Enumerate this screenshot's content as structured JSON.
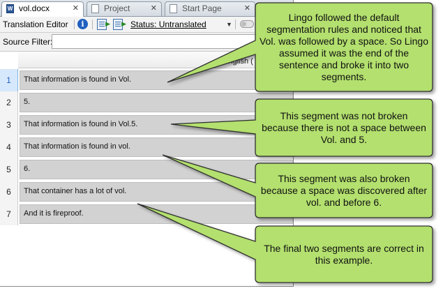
{
  "tabs": [
    {
      "label": "vol.docx",
      "icon": "word-document-icon",
      "close": "✕"
    },
    {
      "label": "Project",
      "icon": "project-icon",
      "close": "✕"
    },
    {
      "label": "Start Page",
      "icon": "start-page-icon",
      "close": "✕"
    }
  ],
  "toolbar": {
    "title": "Translation Editor",
    "info_glyph": "i",
    "status": "Status: Untranslated",
    "dropdown_glyph": "▼"
  },
  "filter": {
    "label": "Source Filter:",
    "value": ""
  },
  "grid": {
    "column_header": "English (",
    "rows": [
      {
        "num": "1",
        "text": "That information is found in Vol."
      },
      {
        "num": "2",
        "text": "5."
      },
      {
        "num": "3",
        "text": "That information is found in Vol.5."
      },
      {
        "num": "4",
        "text": "That information is found in vol."
      },
      {
        "num": "5",
        "text": "6."
      },
      {
        "num": "6",
        "text": "That container has a lot of vol."
      },
      {
        "num": "7",
        "text": "And it is fireproof."
      }
    ]
  },
  "callouts": [
    {
      "text": "Lingo followed the default segmentation rules and noticed that Vol. was followed by a space. So Lingo assumed it was the end of the sentence and broke it into two segments."
    },
    {
      "text": "This segment was not broken because there is not a space between Vol. and 5."
    },
    {
      "text": "This segment was also broken because a space was discovered after vol. and before 6."
    },
    {
      "text": "The final two segments are correct in this example."
    }
  ],
  "colors": {
    "callout_fill": "#b3e06e",
    "callout_stroke": "#2e2e2e",
    "cell_bg": "#d2d2d2",
    "selected_row": "#1f5fbf"
  }
}
